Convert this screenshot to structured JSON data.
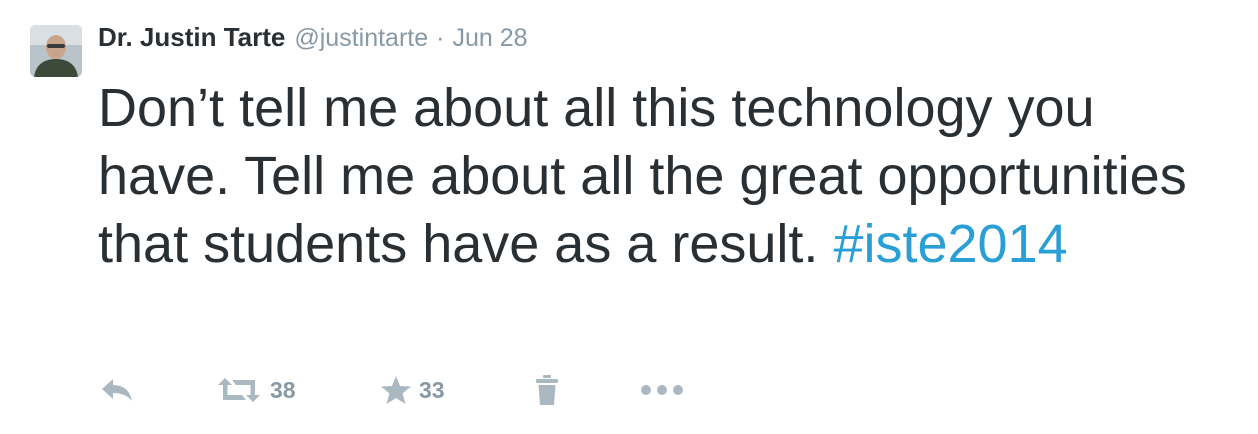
{
  "tweet": {
    "author_name": "Dr. Justin Tarte",
    "handle": "@justintarte",
    "separator": "·",
    "date": "Jun 28",
    "text_main": "Don’t tell me about all this technology you have. Tell me about all the great opportunities that students have as a result. ",
    "hashtag": "#iste2014"
  },
  "actions": {
    "reply_icon": "reply-icon",
    "retweet_icon": "retweet-icon",
    "retweet_count": "38",
    "favorite_icon": "star-icon",
    "favorite_count": "33",
    "delete_icon": "trash-icon",
    "more_icon": "ellipsis-icon"
  },
  "colors": {
    "text": "#292f33",
    "muted": "#8899a6",
    "hashtag": "#2a9fd6",
    "icon": "#aab8c2"
  }
}
